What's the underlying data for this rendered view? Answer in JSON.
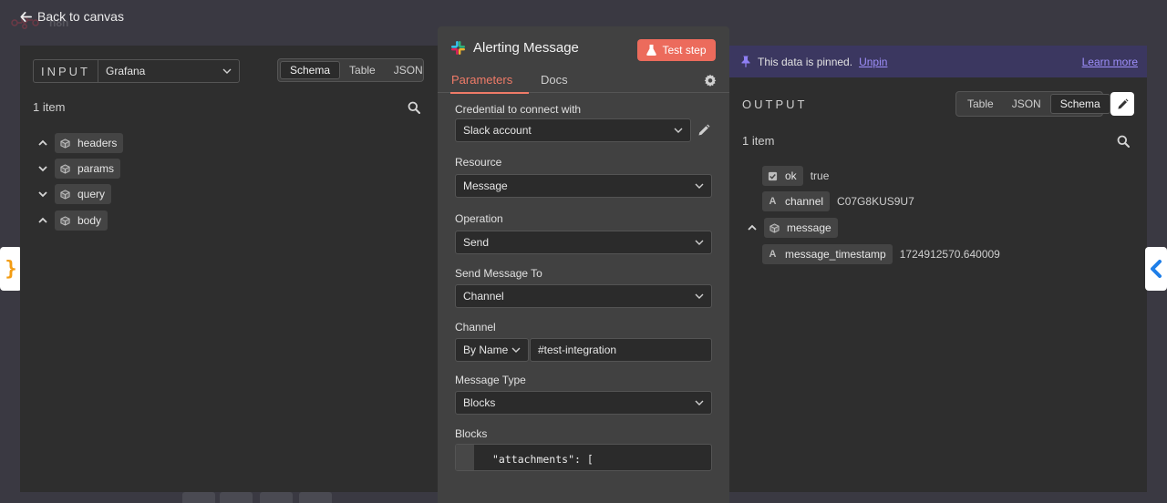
{
  "header": {
    "logo_text": "n8n",
    "back_label": "Back to canvas"
  },
  "input": {
    "title": "INPUT",
    "source": "Grafana",
    "view_tabs": [
      "Schema",
      "Table",
      "JSON"
    ],
    "active_view": "Schema",
    "item_count": "1 item",
    "fields": [
      {
        "name": "headers",
        "expanded": true
      },
      {
        "name": "params",
        "expanded": false
      },
      {
        "name": "query",
        "expanded": false
      },
      {
        "name": "body",
        "expanded": true
      }
    ]
  },
  "node": {
    "title": "Alerting Message",
    "test_button": "Test step",
    "tabs": [
      "Parameters",
      "Docs"
    ],
    "active_tab": "Parameters",
    "params": {
      "credential_label": "Credential to connect with",
      "credential_value": "Slack account",
      "resource_label": "Resource",
      "resource_value": "Message",
      "operation_label": "Operation",
      "operation_value": "Send",
      "send_to_label": "Send Message To",
      "send_to_value": "Channel",
      "channel_label": "Channel",
      "channel_mode": "By Name",
      "channel_value": "#test-integration",
      "message_type_label": "Message Type",
      "message_type_value": "Blocks",
      "blocks_label": "Blocks",
      "blocks_code": "\"attachments\": ["
    }
  },
  "output": {
    "pinned_text": "This data is pinned.",
    "unpin": "Unpin",
    "learn_more": "Learn more",
    "title": "OUTPUT",
    "view_tabs": [
      "Table",
      "JSON",
      "Schema"
    ],
    "active_view": "Schema",
    "item_count": "1 item",
    "fields": [
      {
        "type": "boolean",
        "name": "ok",
        "value": "true"
      },
      {
        "type": "string",
        "name": "channel",
        "value": "C07G8KUS9U7"
      },
      {
        "type": "object",
        "name": "message",
        "value": ""
      },
      {
        "type": "string",
        "name": "message_timestamp",
        "value": "1724912570.640009"
      }
    ]
  },
  "colors": {
    "accent": "#ef7b68",
    "test_button": "#ec6b5c",
    "pinned_bg": "#3b3760",
    "link": "#9e8ffb"
  }
}
